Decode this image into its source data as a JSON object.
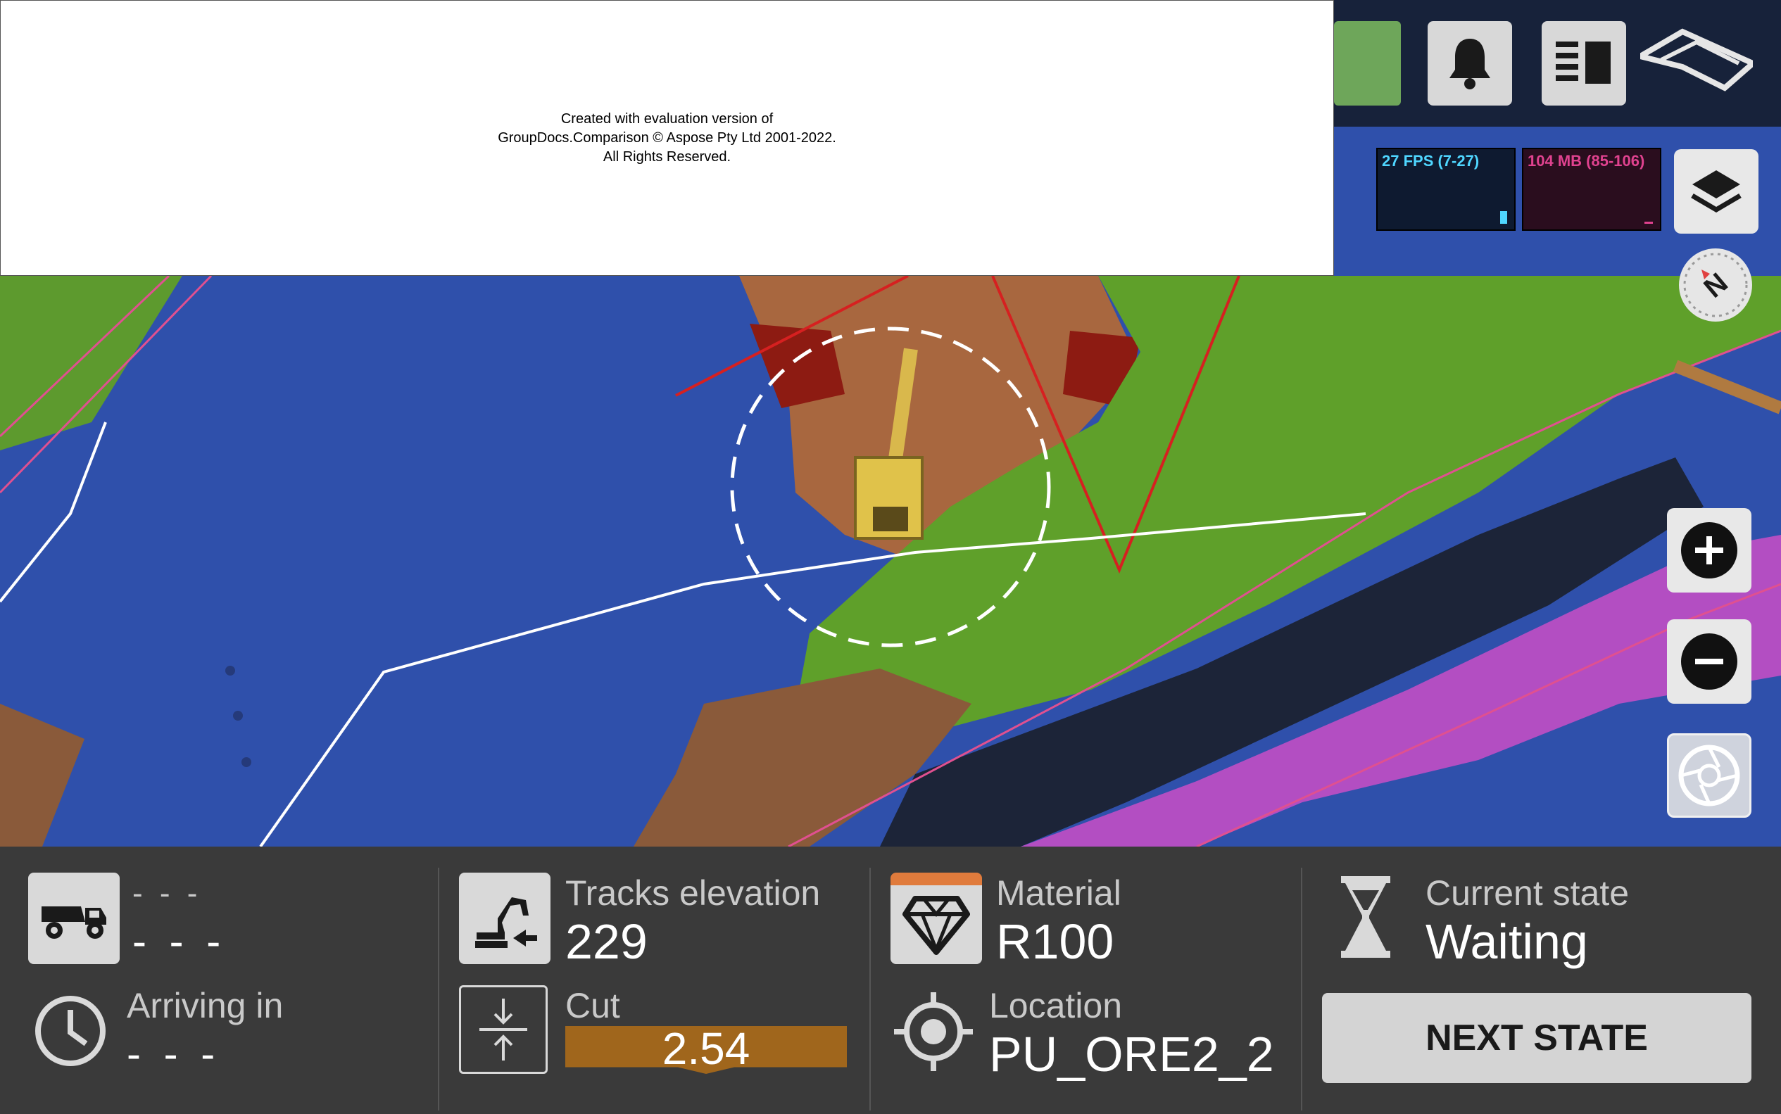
{
  "watermark": {
    "line1": "Created with evaluation version of",
    "line2": "GroupDocs.Comparison © Aspose Pty Ltd 2001-2022.",
    "line3": "All Rights Reserved."
  },
  "topbar": {
    "icons": [
      "bell-icon",
      "layout-panel-icon",
      "brand-logo"
    ]
  },
  "stats": {
    "fps": "27 FPS (7-27)",
    "fps_color": "#4fd6ff",
    "memory": "104 MB (85-106)",
    "memory_color": "#e0428f"
  },
  "map_controls": {
    "icons": [
      "layers-icon",
      "compass-icon",
      "zoom-in-icon",
      "zoom-out-icon",
      "camera-shutter-icon"
    ]
  },
  "panel": {
    "truck": {
      "title": "- - -",
      "value": "- - -"
    },
    "arrival": {
      "label": "Arriving in",
      "value": "- - -"
    },
    "tracks": {
      "label": "Tracks elevation",
      "value": "229"
    },
    "cut": {
      "label": "Cut",
      "value": "2.54",
      "color": "#a0661c"
    },
    "material": {
      "label": "Material",
      "value": "R100",
      "accent": "#e07b3c"
    },
    "location": {
      "label": "Location",
      "value": "PU_ORE2_2"
    },
    "state": {
      "label": "Current state",
      "value": "Waiting"
    },
    "next_button": "NEXT STATE"
  }
}
